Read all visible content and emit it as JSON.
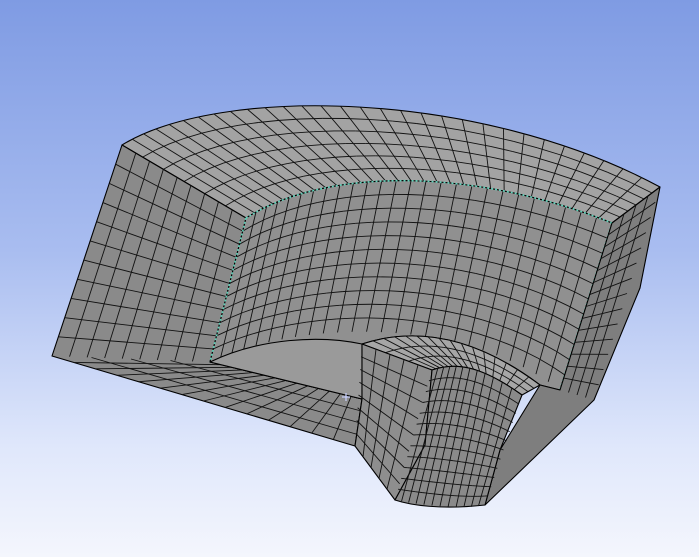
{
  "viewport": {
    "background_top": "#7f9be3",
    "background_bottom": "#f4f6fd"
  },
  "model": {
    "face_color": "#8c8c8c",
    "face_color_light": "#a3a3a3",
    "face_color_dark": "#777777",
    "mesh_line_color": "#111111",
    "selected_edge_color": "#5fd0b8"
  },
  "icons": {
    "center_marker": "crosshair-icon"
  }
}
